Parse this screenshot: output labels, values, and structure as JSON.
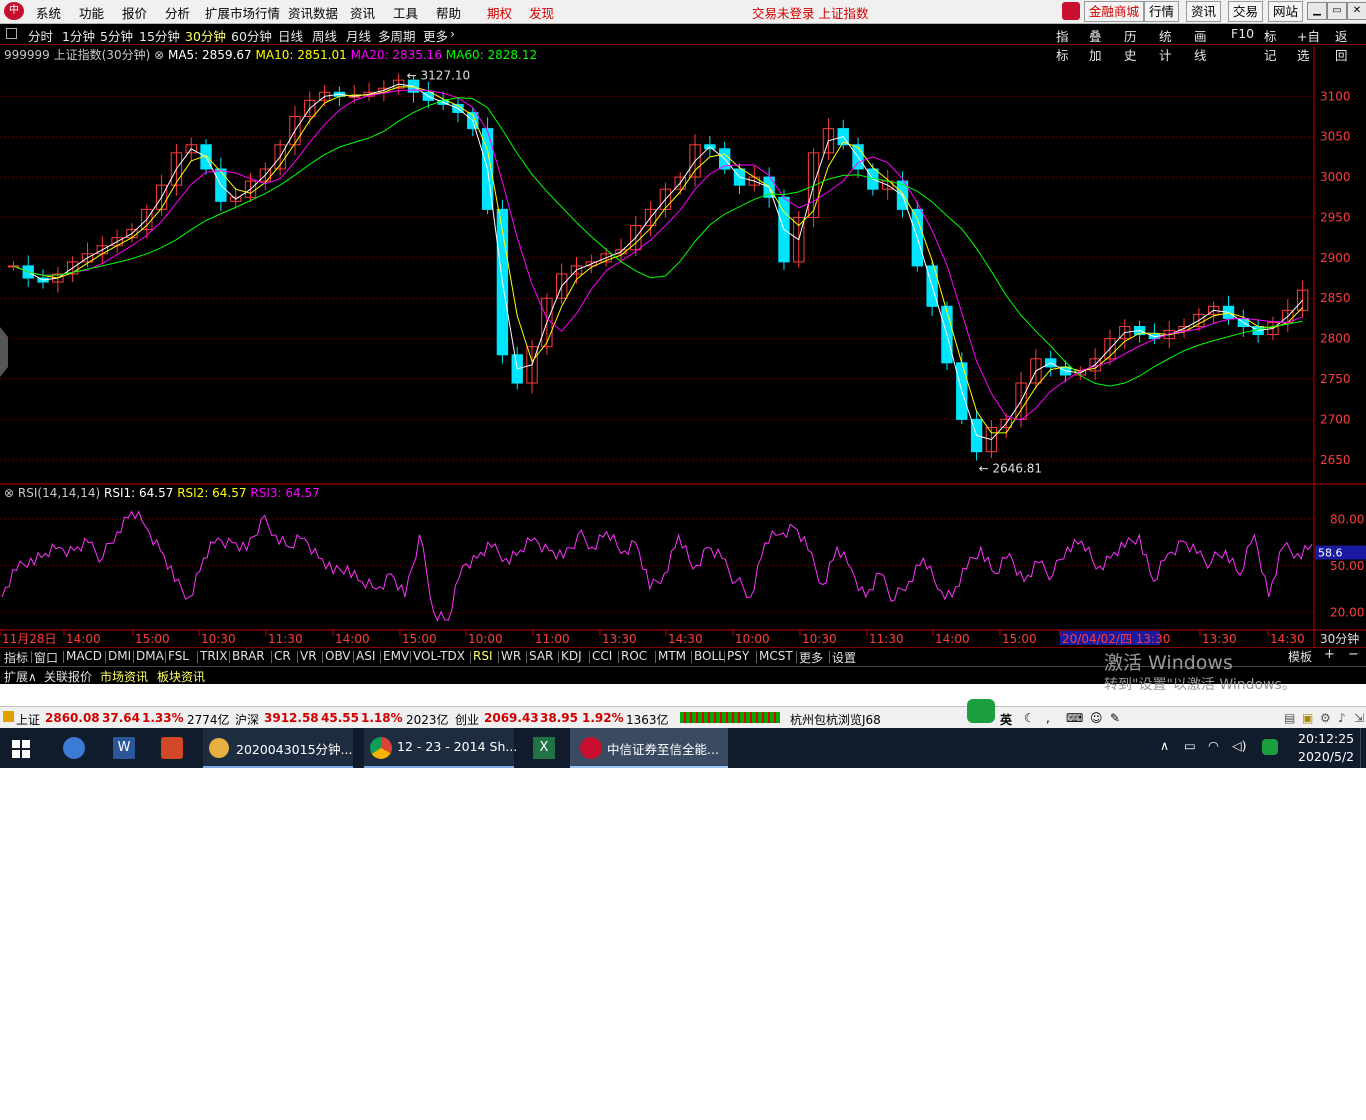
{
  "menu": {
    "items": [
      "系统",
      "功能",
      "报价",
      "分析",
      "扩展市场行情",
      "资讯数据",
      "资讯",
      "工具",
      "帮助"
    ],
    "qiquan": "期权",
    "faxian": "发现",
    "status": "交易未登录 上证指数",
    "right_buttons": [
      "金融商城",
      "行情",
      "资讯",
      "交易",
      "网站"
    ]
  },
  "periods": {
    "items": [
      "分时",
      "1分钟",
      "5分钟",
      "15分钟",
      "30分钟",
      "60分钟",
      "日线",
      "周线",
      "月线",
      "多周期",
      "更多"
    ],
    "selected": "30分钟"
  },
  "right_tools": [
    "指标",
    "叠加",
    "历史",
    "统计",
    "画线",
    "F10",
    "标记",
    "+自选",
    "返回"
  ],
  "main_legend": {
    "symbol": "999999 上证指数(30分钟)",
    "ma5": "MA5: 2859.67",
    "ma10": "MA10: 2851.01",
    "ma20": "MA20: 2835.16",
    "ma60": "MA60: 2828.12"
  },
  "rsi_legend": {
    "name": "RSI(14,14,14)",
    "rsi1": "RSI1: 64.57",
    "rsi2": "RSI2: 64.57",
    "rsi3": "RSI3: 64.57"
  },
  "price_axis": [
    "3100",
    "3050",
    "3000",
    "2950",
    "2900",
    "2850",
    "2800",
    "2750",
    "2700",
    "2650"
  ],
  "rsi_axis": [
    "80.00",
    "50.00",
    "20.00"
  ],
  "rsi_current": "58.6",
  "annotations": {
    "high": "3127.10",
    "low": "2646.81"
  },
  "time_axis": [
    "11月28日",
    "14:00",
    "15:00",
    "10:30",
    "11:30",
    "14:00",
    "15:00",
    "10:00",
    "11:00",
    "13:30",
    "14:30",
    "10:00",
    "10:30",
    "11:30",
    "14:00",
    "15:00",
    "20/04/02/四 13:30",
    "13:30",
    "14:30"
  ],
  "period_label": "30分钟",
  "indicators": [
    "指标",
    "窗口",
    "MACD",
    "DMI",
    "DMA",
    "FSL",
    "TRIX",
    "BRAR",
    "CR",
    "VR",
    "OBV",
    "ASI",
    "EMV",
    "VOL-TDX",
    "RSI",
    "WR",
    "SAR",
    "KDJ",
    "CCI",
    "ROC",
    "MTM",
    "BOLL",
    "PSY",
    "MCST",
    "更多",
    "设置"
  ],
  "indicator_selected": "RSI",
  "template_btn": "模板",
  "subtabs": [
    "扩展∧",
    "关联报价",
    "市场资讯",
    "板块资讯"
  ],
  "watermark": {
    "line1": "激活 Windows",
    "line2": "转到\"设置\"以激活 Windows。"
  },
  "strip": {
    "sh_name": "上证",
    "sh_val": "2860.08",
    "sh_chg": "37.64",
    "sh_pct": "1.33%",
    "sh_amt": "2774亿",
    "hs_name": "沪深",
    "hs_val": "3912.58",
    "hs_chg": "45.55",
    "hs_pct": "1.18%",
    "hs_amt": "2023亿",
    "cy_name": "创业",
    "cy_val": "2069.43",
    "cy_chg": "38.95",
    "cy_pct": "1.92%",
    "cy_amt": "1363亿",
    "server": "杭州包杭浏览J68",
    "ime": "英"
  },
  "taskbar": {
    "items": [
      "2020043015分钟...",
      "12 - 23 - 2014 Sh...",
      "中信证券至信全能..."
    ],
    "time": "20:12:25",
    "date": "2020/5/2"
  },
  "chart_data": {
    "type": "candlestick",
    "price_ylim": [
      2620,
      3140
    ],
    "ma_series": [
      {
        "name": "MA5"
      },
      {
        "name": "MA10"
      },
      {
        "name": "MA20"
      },
      {
        "name": "MA60"
      }
    ],
    "close": [
      2890,
      2875,
      2870,
      2880,
      2895,
      2905,
      2915,
      2925,
      2935,
      2960,
      2990,
      3030,
      3040,
      3010,
      2970,
      2975,
      2995,
      3010,
      3040,
      3075,
      3095,
      3105,
      3100,
      3100,
      3105,
      3110,
      3120,
      3105,
      3095,
      3090,
      3080,
      3060,
      2960,
      2780,
      2745,
      2790,
      2850,
      2880,
      2890,
      2895,
      2905,
      2910,
      2940,
      2960,
      2985,
      3000,
      3040,
      3035,
      3010,
      2990,
      3000,
      2975,
      2895,
      2950,
      3030,
      3060,
      3040,
      3010,
      2985,
      2995,
      2960,
      2890,
      2840,
      2770,
      2700,
      2660,
      2690,
      2700,
      2745,
      2775,
      2765,
      2755,
      2760,
      2775,
      2800,
      2815,
      2805,
      2800,
      2810,
      2815,
      2830,
      2840,
      2825,
      2815,
      2805,
      2820,
      2835,
      2860
    ],
    "rsi": [
      30,
      47,
      55,
      58,
      62,
      60,
      65,
      55,
      72,
      85,
      75,
      60,
      40,
      30,
      55,
      68,
      65,
      60,
      80,
      70,
      62,
      68,
      55,
      45,
      50,
      40,
      35,
      45,
      30,
      70,
      20,
      15,
      50,
      55,
      62,
      55,
      60,
      68,
      60,
      55,
      70,
      62,
      72,
      58,
      65,
      35,
      45,
      70,
      48,
      62,
      55,
      40,
      30,
      65,
      70,
      75,
      60,
      38,
      62,
      48,
      30,
      45,
      28,
      40,
      55,
      35,
      30,
      48,
      62,
      45,
      58,
      40,
      52,
      44,
      62,
      66,
      48,
      55,
      62,
      70,
      40,
      58,
      66,
      58,
      52,
      60,
      44,
      70,
      30,
      62,
      58,
      64
    ]
  }
}
